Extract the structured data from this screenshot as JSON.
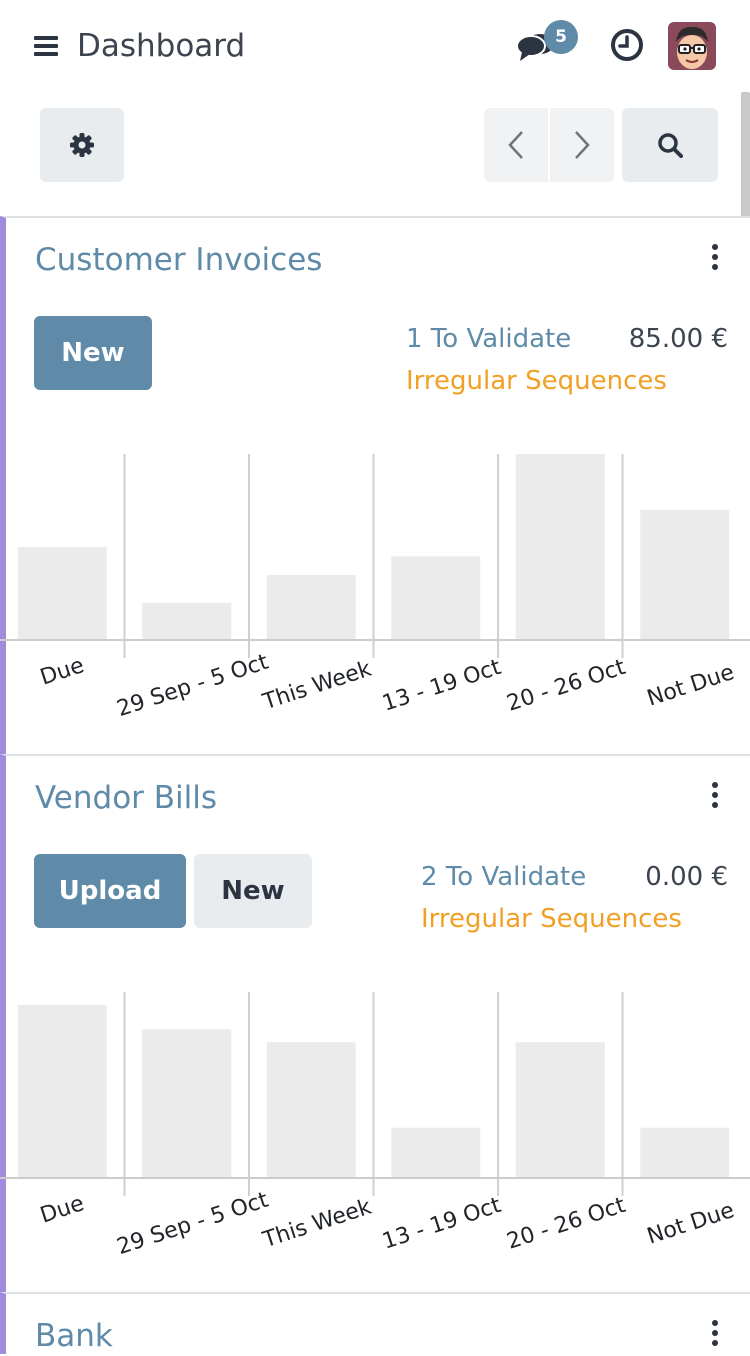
{
  "header": {
    "title": "Dashboard",
    "messages_badge": "5",
    "icons": [
      "menu-icon",
      "chat-icon",
      "clock-icon",
      "user-avatar"
    ]
  },
  "control_panel": {
    "icons": [
      "gear-icon",
      "chevron-left-icon",
      "chevron-right-icon",
      "search-icon"
    ]
  },
  "colors": {
    "primary": "#5f8ba9",
    "warning": "#f0a025",
    "card_accent": "#a08bdc",
    "bar": "#ebebeb"
  },
  "cards": [
    {
      "title": "Customer Invoices",
      "primary_button": "New",
      "to_validate": "1 To Validate",
      "amount": "85.00 €",
      "warning": "Irregular Sequences"
    },
    {
      "title": "Vendor Bills",
      "primary_button": "Upload",
      "secondary_button": "New",
      "to_validate": "2 To Validate",
      "amount": "0.00 €",
      "warning": "Irregular Sequences"
    },
    {
      "title": "Bank"
    }
  ],
  "chart_data": [
    {
      "type": "bar",
      "categories": [
        "Due",
        "29 Sep - 5 Oct",
        "This Week",
        "13 - 19 Oct",
        "20 - 26 Oct",
        "Not Due"
      ],
      "values": [
        0.5,
        0.2,
        0.35,
        0.45,
        1.0,
        0.7
      ],
      "ylim": [
        0,
        1
      ],
      "grid": true
    },
    {
      "type": "bar",
      "categories": [
        "Due",
        "29 Sep - 5 Oct",
        "This Week",
        "13 - 19 Oct",
        "20 - 26 Oct",
        "Not Due"
      ],
      "values": [
        0.93,
        0.8,
        0.73,
        0.27,
        0.73,
        0.27
      ],
      "ylim": [
        0,
        1
      ],
      "grid": true
    }
  ]
}
